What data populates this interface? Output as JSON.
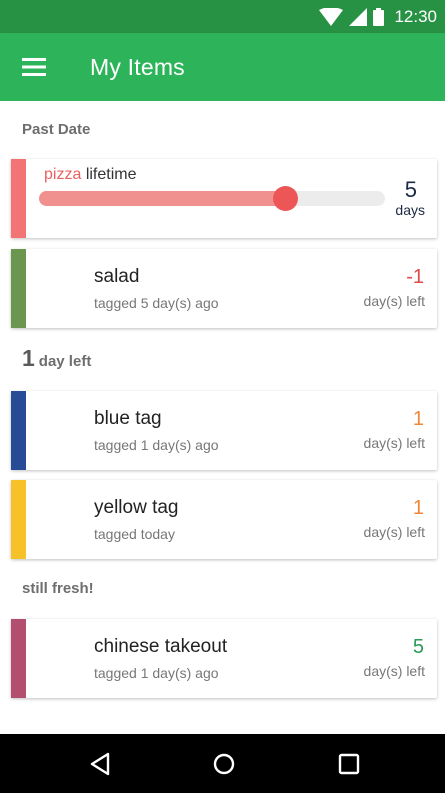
{
  "status_bar": {
    "time": "12:30"
  },
  "app_bar": {
    "title": "My Items"
  },
  "sections": {
    "past_date": "Past Date",
    "one_day_num": "1",
    "one_day_label": "day left",
    "fresh": "still fresh!"
  },
  "pizza": {
    "name": "pizza",
    "label": "lifetime",
    "value": "5",
    "unit": "days",
    "slider_fraction": 0.71
  },
  "items": [
    {
      "name": "salad",
      "subtitle": "tagged 5 day(s) ago",
      "days": "-1",
      "unit": "day(s) left",
      "bar_color": "#6a964f",
      "days_color": "#e34a4a"
    },
    {
      "name": "blue tag",
      "subtitle": "tagged 1 day(s) ago",
      "days": "1",
      "unit": "day(s) left",
      "bar_color": "#274b94",
      "days_color": "#f0883a"
    },
    {
      "name": "yellow tag",
      "subtitle": "tagged today",
      "days": "1",
      "unit": "day(s) left",
      "bar_color": "#f7c12a",
      "days_color": "#f0883a"
    },
    {
      "name": "chinese takeout",
      "subtitle": "tagged 1 day(s) ago",
      "days": "5",
      "unit": "day(s) left",
      "bar_color": "#b34f6e",
      "days_color": "#2a9a55"
    }
  ],
  "colors": {
    "status_bar": "#279244",
    "app_bar": "#2db35a",
    "pizza_bar": "#f27474",
    "slider_thumb": "#ec5656"
  }
}
